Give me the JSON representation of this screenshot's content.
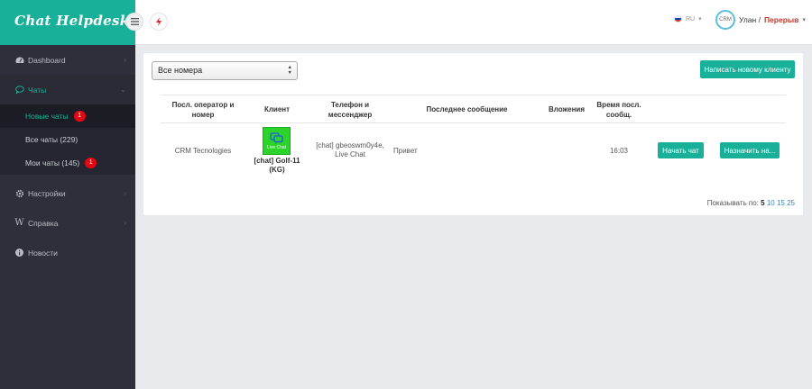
{
  "brand": {
    "title": "Chat Helpdesk"
  },
  "header": {
    "language": "RU",
    "user_name": "Улан /",
    "user_status": "Перерыв",
    "avatar_text": "CRM"
  },
  "sidebar": {
    "items": [
      {
        "label": "Dashboard",
        "icon": "dashboard-icon"
      },
      {
        "label": "Чаты",
        "icon": "chat-icon"
      },
      {
        "label": "Настройки",
        "icon": "gear-icon"
      },
      {
        "label": "Справка",
        "icon": "wikipedia-icon"
      },
      {
        "label": "Новости",
        "icon": "info-icon"
      }
    ],
    "chats_sub": [
      {
        "label": "Новые чаты",
        "badge": "1"
      },
      {
        "label": "Все чаты (229)",
        "badge": ""
      },
      {
        "label": "Мои чаты (145)",
        "badge": "1"
      }
    ]
  },
  "main": {
    "number_select": "Все номера",
    "write_button": "Написать новому клиенту",
    "columns": [
      "Посл. оператор и номер",
      "Клиент",
      "Телефон и мессенджер",
      "Последнее сообщение",
      "Вложения",
      "Время посл. сообщ."
    ],
    "row": {
      "operator": "CRM Tecnologies",
      "livechat_label": "Live Chat",
      "client": "[chat] Golf-11 (KG)",
      "phone": "[chat] gbeoswm0y4e, Live Chat",
      "last_message": "Привет",
      "attachments": "",
      "time": "16:03",
      "start_button": "Начать чат",
      "assign_button": "Назначить на..."
    },
    "pager": {
      "label": "Показывать по:",
      "current": "5",
      "opt1": "10",
      "opt2": "15",
      "opt3": "25"
    }
  },
  "colors": {
    "accent": "#19b09a",
    "sidebar": "#2e2f3a",
    "badge": "#e30613",
    "status": "#c0392b"
  }
}
